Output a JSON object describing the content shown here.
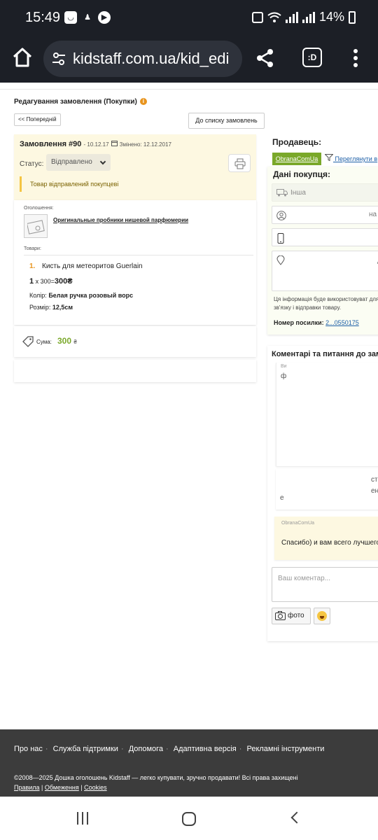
{
  "status_bar": {
    "time": "15:49",
    "battery": "14%"
  },
  "browser": {
    "url": "kidstaff.com.ua/kid_edi",
    "tab_label": ":D"
  },
  "page": {
    "title": "Редагування замовлення (Покупки)",
    "prev_button": "<< Попередній",
    "list_button": "До списку замовлень"
  },
  "order": {
    "title": "Замовлення #90",
    "date": "- 10.12.17",
    "changed": "Змінено: 12.12.2017",
    "status_label": "Статус:",
    "status_value": "Відправлено",
    "notice": "Товар відправлений покупцеві"
  },
  "items": {
    "ad_label": "Оголошення:",
    "ad_title": "Оригинальные пробники нишевой парфюмерии",
    "goods_label": "Товари:",
    "list": [
      {
        "num": "1.",
        "name": "Кисть для метеоритов Guerlain",
        "qty": "1",
        "price_expr": "x 300=",
        "total": "300₴",
        "color_label": "Колір:",
        "color_value": "Белая ручка розовый ворс",
        "size_label": "Розмір:",
        "size_value": "12,5см"
      }
    ]
  },
  "summary": {
    "label": "Сума:",
    "value": "300",
    "currency": "₴"
  },
  "seller": {
    "title": "Продавець:",
    "name": "ObranaComUa",
    "filter_link": "Переглянути в"
  },
  "buyer": {
    "title": "Дані покупця:",
    "delivery": "Інша",
    "name_tail": "на",
    "addr_tail": "д",
    "note": "Ця інформація буде використовуват для зв'язку і відправки товару.",
    "track_label": "Номер посилки:",
    "track_value": "2...0550175"
  },
  "comments": {
    "title": "Коментарі та питання до зам",
    "c1_label": "Ви",
    "c1_mark": "ф",
    "c2_line1": "ст",
    "c2_line2": "ен",
    "c2_line3": "е",
    "c3_author": "ObranaComUa",
    "c3_text": "Спасибо) и вам всего лучшего",
    "input_placeholder": "Ваш коментар...",
    "photo_button": "фото"
  },
  "footer": {
    "links": [
      "Про нас",
      "Служба підтримки",
      "Допомога",
      "Адаптивна версія",
      "Рекламні інструменти"
    ],
    "copyright": "©2008—2025 Дошка оголошень Kidstaff — легко купувати, зручно продавати! Всі права захищені",
    "legal": [
      "Правила",
      "Обмеження",
      "Cookies"
    ]
  },
  "colors": {
    "accent_green": "#7aa82a",
    "warning_yellow": "#f5c542",
    "orange": "#e8941e",
    "link_blue": "#1d5fa7"
  }
}
